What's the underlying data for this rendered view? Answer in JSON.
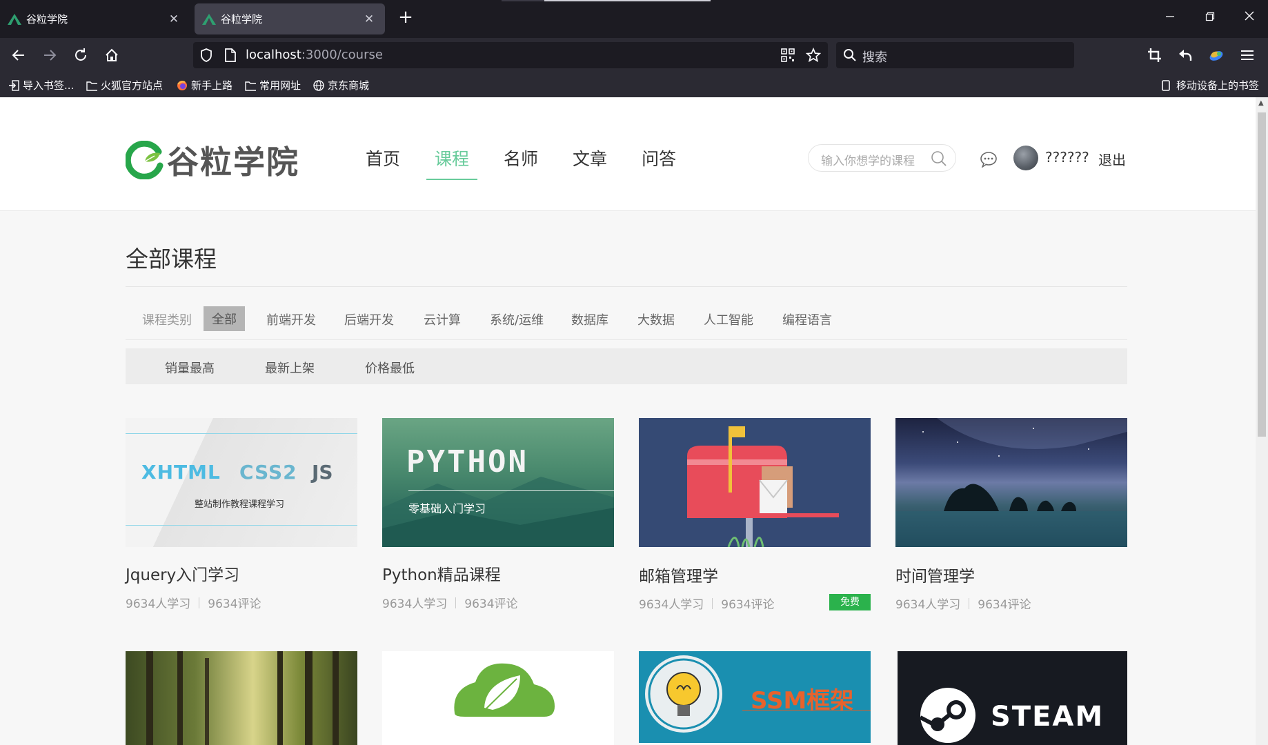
{
  "browser": {
    "tabs": [
      {
        "title": "谷粒学院"
      },
      {
        "title": "谷粒学院"
      }
    ],
    "url": {
      "host": "localhost",
      "path": ":3000/course"
    },
    "search_placeholder": "搜索",
    "bookmarks": [
      {
        "label": "导入书签...",
        "icon": "import-icon"
      },
      {
        "label": "火狐官方站点",
        "icon": "folder-icon"
      },
      {
        "label": "新手上路",
        "icon": "firefox-icon"
      },
      {
        "label": "常用网址",
        "icon": "folder-icon"
      },
      {
        "label": "京东商城",
        "icon": "globe-icon"
      },
      {
        "label": "移动设备上的书签",
        "icon": "mobile-icon"
      }
    ]
  },
  "site": {
    "logo_text": "谷粒学院",
    "nav": [
      {
        "label": "首页",
        "active": false
      },
      {
        "label": "课程",
        "active": true
      },
      {
        "label": "名师",
        "active": false
      },
      {
        "label": "文章",
        "active": false
      },
      {
        "label": "问答",
        "active": false
      }
    ],
    "search_placeholder": "输入你想学的课程",
    "username": "??????",
    "logout_label": "退出",
    "accent_color": "#68cb9b"
  },
  "courses_page": {
    "title": "全部课程",
    "category_label": "课程类别",
    "categories": [
      "全部",
      "前端开发",
      "后端开发",
      "云计算",
      "系统/运维",
      "数据库",
      "大数据",
      "人工智能",
      "编程语言"
    ],
    "active_category": "全部",
    "sorts": [
      "销量最高",
      "最新上架",
      "价格最低"
    ],
    "cards": [
      {
        "title": "Jquery入门学习",
        "students": "9634人学习",
        "comments": "9634评论",
        "free": false,
        "image": {
          "texts": [
            "XHTML",
            "CSS2",
            "JS"
          ],
          "subtitle": "整站制作教程课程学习"
        }
      },
      {
        "title": "Python精品课程",
        "students": "9634人学习",
        "comments": "9634评论",
        "free": false,
        "image": {
          "texts": [
            "PYTHON"
          ],
          "subtitle": "零基础入门学习"
        }
      },
      {
        "title": "邮箱管理学",
        "students": "9634人学习",
        "comments": "9634评论",
        "free": true,
        "free_label": "免费",
        "image": {
          "texts": []
        }
      },
      {
        "title": "时间管理学",
        "students": "9634人学习",
        "comments": "9634评论",
        "free": false,
        "image": {
          "texts": []
        }
      },
      {
        "title": "",
        "image": {
          "texts": []
        }
      },
      {
        "title": "",
        "image": {
          "texts": []
        }
      },
      {
        "title": "",
        "image": {
          "texts": [
            "SSM框架"
          ]
        }
      },
      {
        "title": "",
        "image": {
          "texts": [
            "STEAM"
          ]
        }
      }
    ]
  }
}
